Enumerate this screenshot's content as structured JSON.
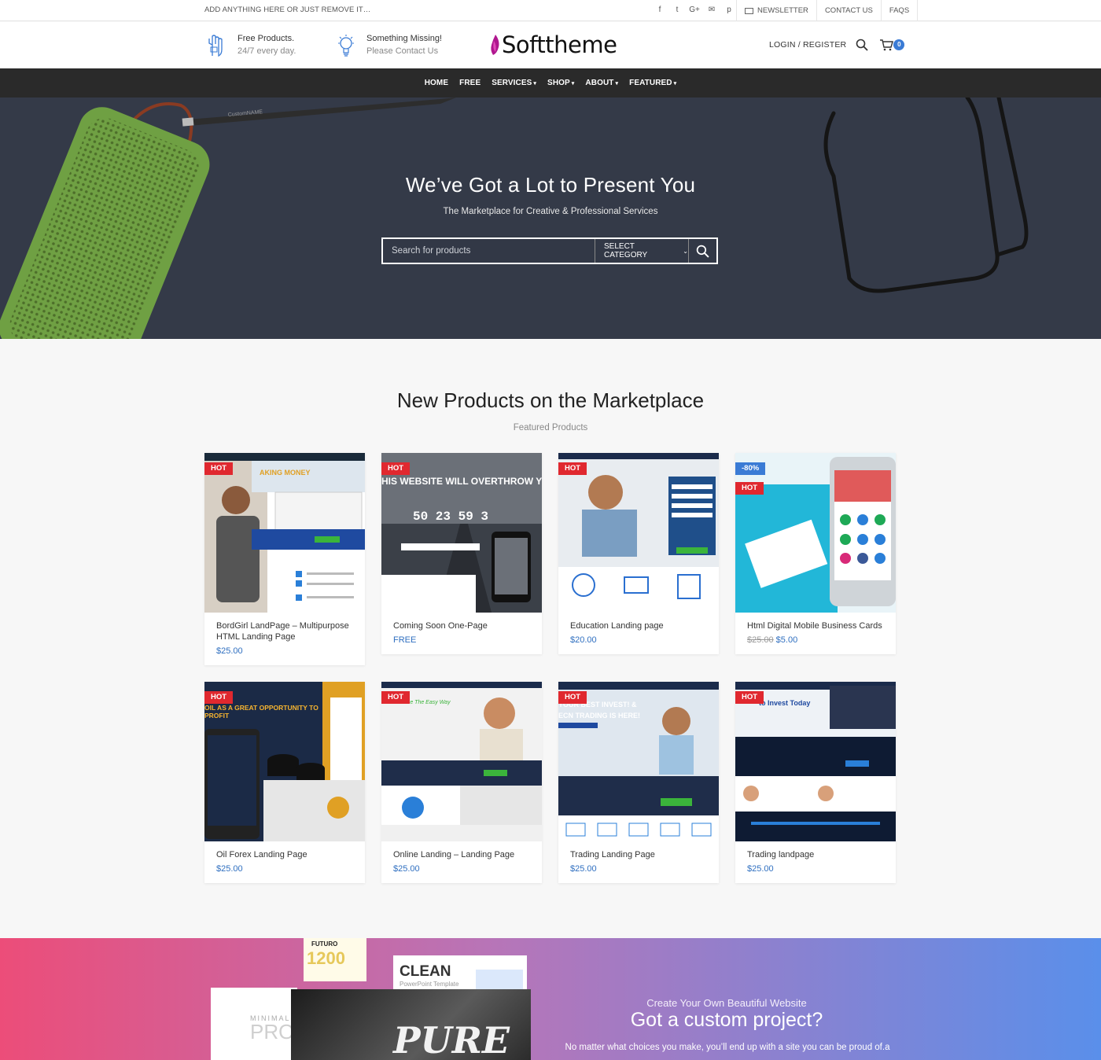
{
  "topbar": {
    "message": "ADD ANYTHING HERE OR JUST REMOVE IT…",
    "social_icons": [
      "facebook-icon",
      "twitter-icon",
      "google-plus-icon",
      "envelope-icon",
      "pinterest-icon"
    ],
    "social_glyphs": [
      "f",
      "t",
      "G+",
      "✉",
      "p"
    ],
    "newsletter": "NEWSLETTER",
    "contact": "CONTACT US",
    "faqs": "FAQS"
  },
  "header": {
    "feature1_title": "Free Products.",
    "feature1_sub": "24/7 every day.",
    "feature2_title": "Something Missing!",
    "feature2_sub": "Please Contact Us",
    "logo": "Softtheme",
    "login": "LOGIN / REGISTER",
    "cart_count": "0"
  },
  "nav": {
    "items": [
      {
        "label": "HOME",
        "dropdown": false
      },
      {
        "label": "FREE",
        "dropdown": false
      },
      {
        "label": "SERVICES",
        "dropdown": true
      },
      {
        "label": "SHOP",
        "dropdown": true
      },
      {
        "label": "ABOUT",
        "dropdown": true
      },
      {
        "label": "FEATURED",
        "dropdown": true
      }
    ]
  },
  "hero": {
    "title": "We’ve Got a Lot to Present You",
    "subtitle": "The Marketplace for Creative & Professional Services",
    "search_placeholder": "Search for products",
    "category": "SELECT CATEGORY"
  },
  "products_section": {
    "title": "New Products on the Marketplace",
    "subtitle": "Featured Products",
    "items": [
      {
        "name": "BordGirl LandPage – Multipurpose HTML Landing Page",
        "price": "$25.00",
        "old_price": "",
        "tags": [
          "HOT"
        ],
        "thumb": "BORDGIRL"
      },
      {
        "name": "Coming Soon One-Page",
        "price": "FREE",
        "old_price": "",
        "tags": [
          "HOT"
        ],
        "thumb": "COMING SOON"
      },
      {
        "name": "Education Landing page",
        "price": "$20.00",
        "old_price": "",
        "tags": [
          "HOT"
        ],
        "thumb": "EDUCATION"
      },
      {
        "name": "Html Digital Mobile Business Cards",
        "price": "$5.00",
        "old_price": "$25.00",
        "tags": [
          "-80%",
          "HOT"
        ],
        "thumb": "BUSINESS CARD"
      },
      {
        "name": "Oil Forex Landing Page",
        "price": "$25.00",
        "old_price": "",
        "tags": [
          "HOT"
        ],
        "thumb": "OIL FOREX"
      },
      {
        "name": "Online Landing – Landing Page",
        "price": "$25.00",
        "old_price": "",
        "tags": [
          "HOT"
        ],
        "thumb": "ONLINE"
      },
      {
        "name": "Trading Landing Page",
        "price": "$25.00",
        "old_price": "",
        "tags": [
          "HOT"
        ],
        "thumb": "TRADING"
      },
      {
        "name": "Trading landpage",
        "price": "$25.00",
        "old_price": "",
        "tags": [
          "HOT"
        ],
        "thumb": "TRADING 2"
      }
    ]
  },
  "promo": {
    "kicker": "Create Your Own Beautiful Website",
    "title": "Got a custom project?",
    "text": "No matter what choices you make, you’ll end up with a site you can be proud of.a",
    "thumb_clean": "CLEAN",
    "thumb_clean_sub": "PowerPoint Template",
    "thumb_pure": "PURE",
    "thumb_pro": "PRO",
    "thumb_minimal": "MINIMAL",
    "thumb_futuro": "FUTURO"
  },
  "colors": {
    "accent": "#3a7bd5",
    "hot": "#e0282f",
    "nav": "#2a2a2a",
    "hero": "#343a48",
    "price": "#2f6fc0"
  }
}
